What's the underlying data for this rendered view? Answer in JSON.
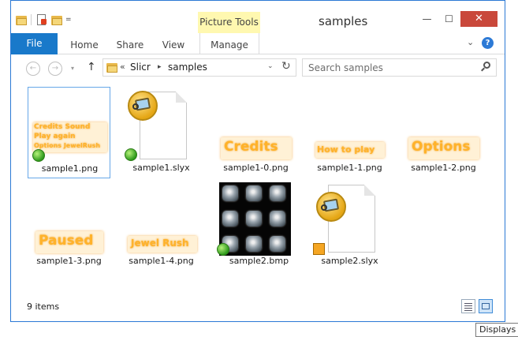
{
  "window": {
    "title": "samples",
    "contextual_tab": "Picture Tools",
    "buttons": {
      "minimize": "—",
      "maximize": "☐",
      "close": "✕"
    }
  },
  "quick_access": {
    "dropdown": "="
  },
  "ribbon": {
    "tabs": [
      "File",
      "Home",
      "Share",
      "View",
      "Manage"
    ],
    "expand": "⌄",
    "help": "?"
  },
  "nav": {
    "back": "←",
    "forward": "→",
    "recent": "▾",
    "up": "↑",
    "address": {
      "overflow": "«",
      "segments": [
        "Slicr",
        "samples"
      ],
      "separator": "▸",
      "dropdown": "⌄"
    },
    "refresh": "↻",
    "search_placeholder": "Search samples"
  },
  "files": [
    {
      "name": "sample1.png",
      "kind": "png-multi",
      "lines": [
        "Credits Sound",
        "Play again",
        "Options JewelRush"
      ],
      "badge": "green",
      "selected": true
    },
    {
      "name": "sample1.slyx",
      "kind": "slyx-doc",
      "badge": "green"
    },
    {
      "name": "sample1-0.png",
      "kind": "png-text",
      "text": "Credits"
    },
    {
      "name": "sample1-1.png",
      "kind": "png-text",
      "text": "How to play"
    },
    {
      "name": "sample1-2.png",
      "kind": "png-text",
      "text": "Options"
    },
    {
      "name": "sample1-3.png",
      "kind": "png-text",
      "text": "Paused"
    },
    {
      "name": "sample1-4.png",
      "kind": "png-text",
      "text": "Jewel Rush"
    },
    {
      "name": "sample2.bmp",
      "kind": "bmp-gems",
      "badge": "green"
    },
    {
      "name": "sample2.slyx",
      "kind": "slyx-doc",
      "badge": "orange"
    }
  ],
  "status": {
    "item_count": "9 items"
  },
  "tooltip": "Displays i",
  "colors": {
    "accent": "#1979ca",
    "close": "#c9483b",
    "picture_tools": "#fff8b0",
    "orange_text": "#ffb22a",
    "selection_border": "#66a7e8"
  }
}
